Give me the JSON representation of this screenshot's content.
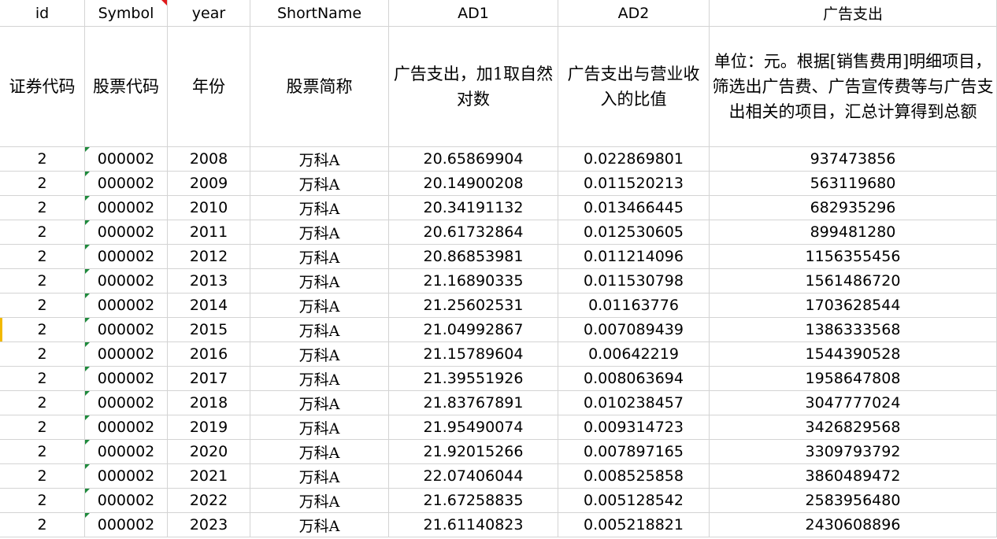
{
  "header": {
    "id": "id",
    "symbol": "Symbol",
    "year": "year",
    "shortname": "ShortName",
    "ad1": "AD1",
    "ad2": "AD2",
    "ad_expense": "广告支出"
  },
  "description": {
    "id": "证券代码",
    "symbol": "股票代码",
    "year": "年份",
    "shortname": "股票简称",
    "ad1": "广告支出，加1取自然对数",
    "ad2": "广告支出与营业收入的比值",
    "ad_expense": "单位：元。根据[销售费用]明细项目，筛选出广告费、广告宣传费等与广告支出相关的项目，汇总计算得到总额"
  },
  "rows": [
    {
      "id": "2",
      "symbol": "000002",
      "year": "2008",
      "shortname": "万科A",
      "ad1": "20.65869904",
      "ad2": "0.022869801",
      "ad_expense": "937473856"
    },
    {
      "id": "2",
      "symbol": "000002",
      "year": "2009",
      "shortname": "万科A",
      "ad1": "20.14900208",
      "ad2": "0.011520213",
      "ad_expense": "563119680"
    },
    {
      "id": "2",
      "symbol": "000002",
      "year": "2010",
      "shortname": "万科A",
      "ad1": "20.34191132",
      "ad2": "0.013466445",
      "ad_expense": "682935296"
    },
    {
      "id": "2",
      "symbol": "000002",
      "year": "2011",
      "shortname": "万科A",
      "ad1": "20.61732864",
      "ad2": "0.012530605",
      "ad_expense": "899481280"
    },
    {
      "id": "2",
      "symbol": "000002",
      "year": "2012",
      "shortname": "万科A",
      "ad1": "20.86853981",
      "ad2": "0.011214096",
      "ad_expense": "1156355456"
    },
    {
      "id": "2",
      "symbol": "000002",
      "year": "2013",
      "shortname": "万科A",
      "ad1": "21.16890335",
      "ad2": "0.011530798",
      "ad_expense": "1561486720"
    },
    {
      "id": "2",
      "symbol": "000002",
      "year": "2014",
      "shortname": "万科A",
      "ad1": "21.25602531",
      "ad2": "0.01163776",
      "ad_expense": "1703628544"
    },
    {
      "id": "2",
      "symbol": "000002",
      "year": "2015",
      "shortname": "万科A",
      "ad1": "21.04992867",
      "ad2": "0.007089439",
      "ad_expense": "1386333568"
    },
    {
      "id": "2",
      "symbol": "000002",
      "year": "2016",
      "shortname": "万科A",
      "ad1": "21.15789604",
      "ad2": "0.00642219",
      "ad_expense": "1544390528"
    },
    {
      "id": "2",
      "symbol": "000002",
      "year": "2017",
      "shortname": "万科A",
      "ad1": "21.39551926",
      "ad2": "0.008063694",
      "ad_expense": "1958647808"
    },
    {
      "id": "2",
      "symbol": "000002",
      "year": "2018",
      "shortname": "万科A",
      "ad1": "21.83767891",
      "ad2": "0.010238457",
      "ad_expense": "3047777024"
    },
    {
      "id": "2",
      "symbol": "000002",
      "year": "2019",
      "shortname": "万科A",
      "ad1": "21.95490074",
      "ad2": "0.009314723",
      "ad_expense": "3426829568"
    },
    {
      "id": "2",
      "symbol": "000002",
      "year": "2020",
      "shortname": "万科A",
      "ad1": "21.92015266",
      "ad2": "0.007897165",
      "ad_expense": "3309793792"
    },
    {
      "id": "2",
      "symbol": "000002",
      "year": "2021",
      "shortname": "万科A",
      "ad1": "22.07406044",
      "ad2": "0.008525858",
      "ad_expense": "3860489472"
    },
    {
      "id": "2",
      "symbol": "000002",
      "year": "2022",
      "shortname": "万科A",
      "ad1": "21.67258835",
      "ad2": "0.005128542",
      "ad_expense": "2583956480"
    },
    {
      "id": "2",
      "symbol": "000002",
      "year": "2023",
      "shortname": "万科A",
      "ad1": "21.61140823",
      "ad2": "0.005218821",
      "ad_expense": "2430608896"
    }
  ],
  "colors": {
    "gridline": "#d4d4d4",
    "number_stored_as_text_marker": "#1e8a3c",
    "comment_marker": "#e0191b",
    "selection_marker": "#f2b900"
  }
}
